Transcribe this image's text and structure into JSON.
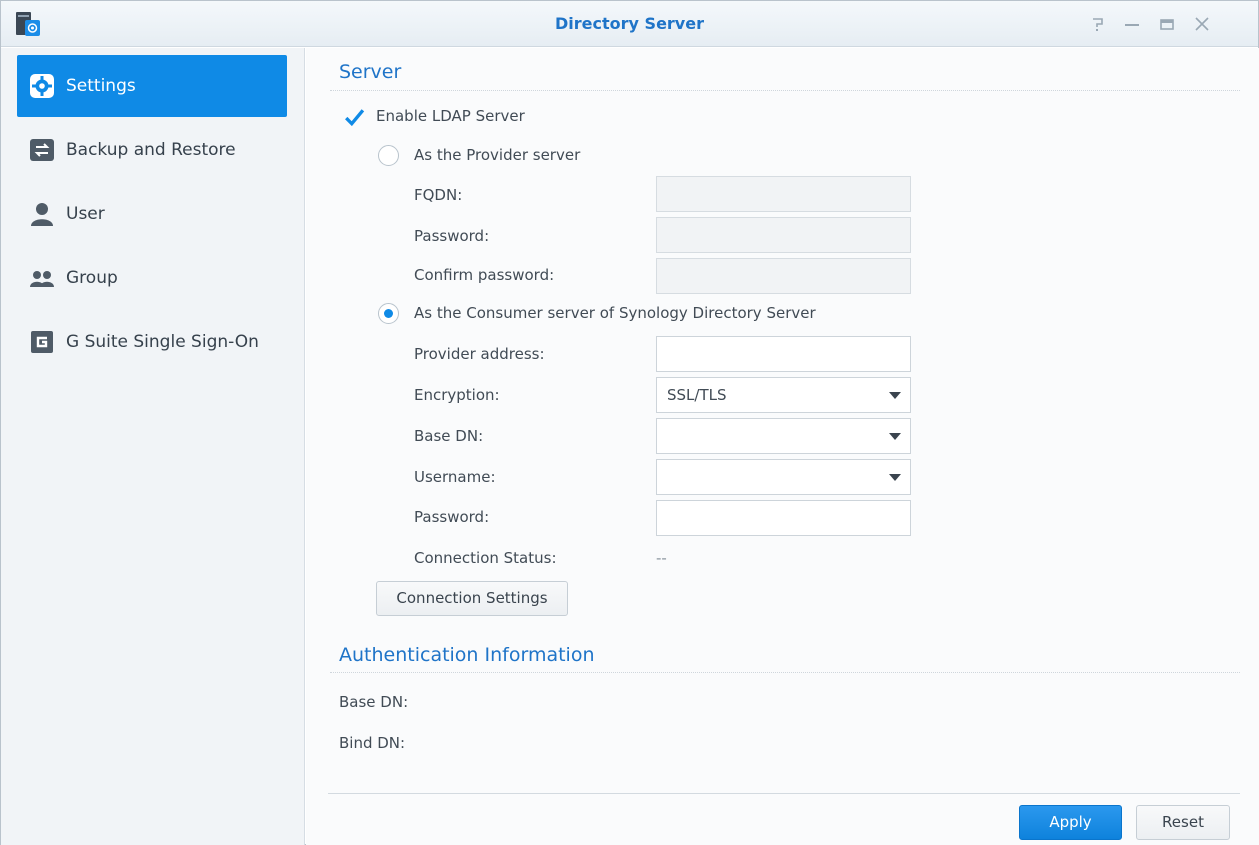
{
  "window": {
    "title": "Directory Server",
    "controls": {
      "help": "?",
      "minimize": "—",
      "maximize": "□",
      "close": "✕"
    }
  },
  "sidebar": {
    "items": [
      {
        "label": "Settings",
        "icon": "gear-icon",
        "active": true
      },
      {
        "label": "Backup and Restore",
        "icon": "backup-restore-icon",
        "active": false
      },
      {
        "label": "User",
        "icon": "user-icon",
        "active": false
      },
      {
        "label": "Group",
        "icon": "group-icon",
        "active": false
      },
      {
        "label": "G Suite Single Sign-On",
        "icon": "g-suite-icon",
        "active": false
      }
    ]
  },
  "server": {
    "title": "Server",
    "enable_ldap": {
      "label": "Enable LDAP Server",
      "checked": true
    },
    "provider": {
      "label": "As the Provider server",
      "selected": false,
      "fqdn_label": "FQDN:",
      "fqdn_value": "",
      "password_label": "Password:",
      "password_value": "",
      "confirm_label": "Confirm password:",
      "confirm_value": ""
    },
    "consumer": {
      "label": "As the Consumer server of Synology Directory Server",
      "selected": true,
      "provider_address_label": "Provider address:",
      "provider_address_value": "",
      "encryption_label": "Encryption:",
      "encryption_value": "SSL/TLS",
      "base_dn_label": "Base DN:",
      "base_dn_value": "",
      "username_label": "Username:",
      "username_value": "",
      "password_label": "Password:",
      "password_value": "",
      "status_label": "Connection Status:",
      "status_value": "--"
    },
    "connection_settings_button": "Connection Settings"
  },
  "auth": {
    "title": "Authentication Information",
    "base_dn_label": "Base DN:",
    "bind_dn_label": "Bind DN:"
  },
  "footer": {
    "apply": "Apply",
    "reset": "Reset"
  },
  "colors": {
    "accent": "#0f8ae6",
    "title": "#1f74c8",
    "sidebar_bg": "#f1f4f7"
  }
}
